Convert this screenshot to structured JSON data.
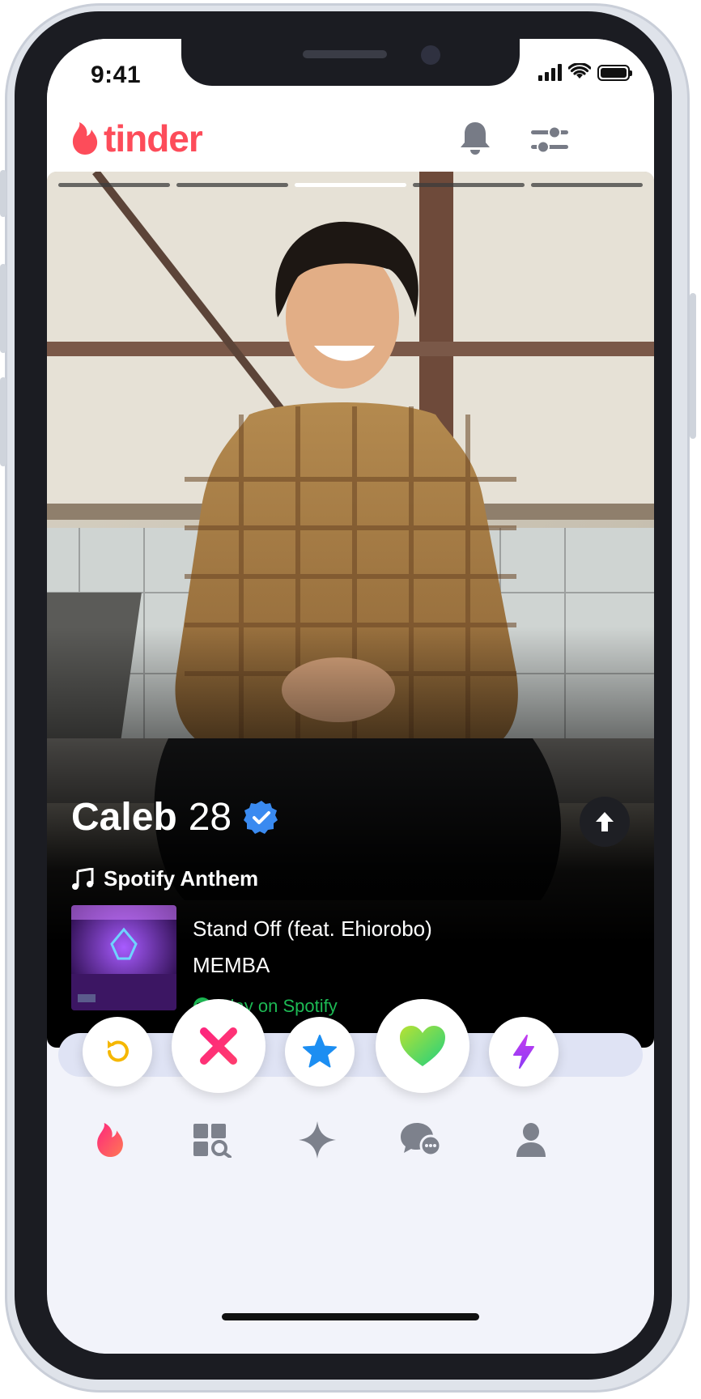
{
  "status_bar": {
    "time": "9:41"
  },
  "header": {
    "logo_text": "tinder",
    "brand_color": "#fd4c5a",
    "icons": [
      "bell-icon",
      "filter-sliders-icon"
    ]
  },
  "card": {
    "photo_count": 5,
    "active_photo_index": 2,
    "name": "Caleb",
    "age": "28",
    "verified": true,
    "anthem_label": "Spotify Anthem",
    "song_title": "Stand Off (feat. Ehiorobo)",
    "song_artist": "MEMBA",
    "play_label": "Play on Spotify",
    "spotify_color": "#1db954"
  },
  "actions": [
    {
      "name": "rewind",
      "icon": "rewind-icon",
      "color": "#f5b700"
    },
    {
      "name": "nope",
      "icon": "x-icon",
      "color": "#fd267d"
    },
    {
      "name": "super-like",
      "icon": "star-icon",
      "color": "#1c8ef2"
    },
    {
      "name": "like",
      "icon": "heart-icon",
      "color": "#3fd07a"
    },
    {
      "name": "boost",
      "icon": "bolt-icon",
      "color": "#b23df1"
    }
  ],
  "tabs": [
    {
      "name": "home",
      "icon": "flame-icon",
      "active": true
    },
    {
      "name": "explore",
      "icon": "explore-grid-icon",
      "active": false
    },
    {
      "name": "gold",
      "icon": "sparkle-icon",
      "active": false
    },
    {
      "name": "messages",
      "icon": "chat-bubbles-icon",
      "active": false
    },
    {
      "name": "profile",
      "icon": "person-icon",
      "active": false
    }
  ]
}
